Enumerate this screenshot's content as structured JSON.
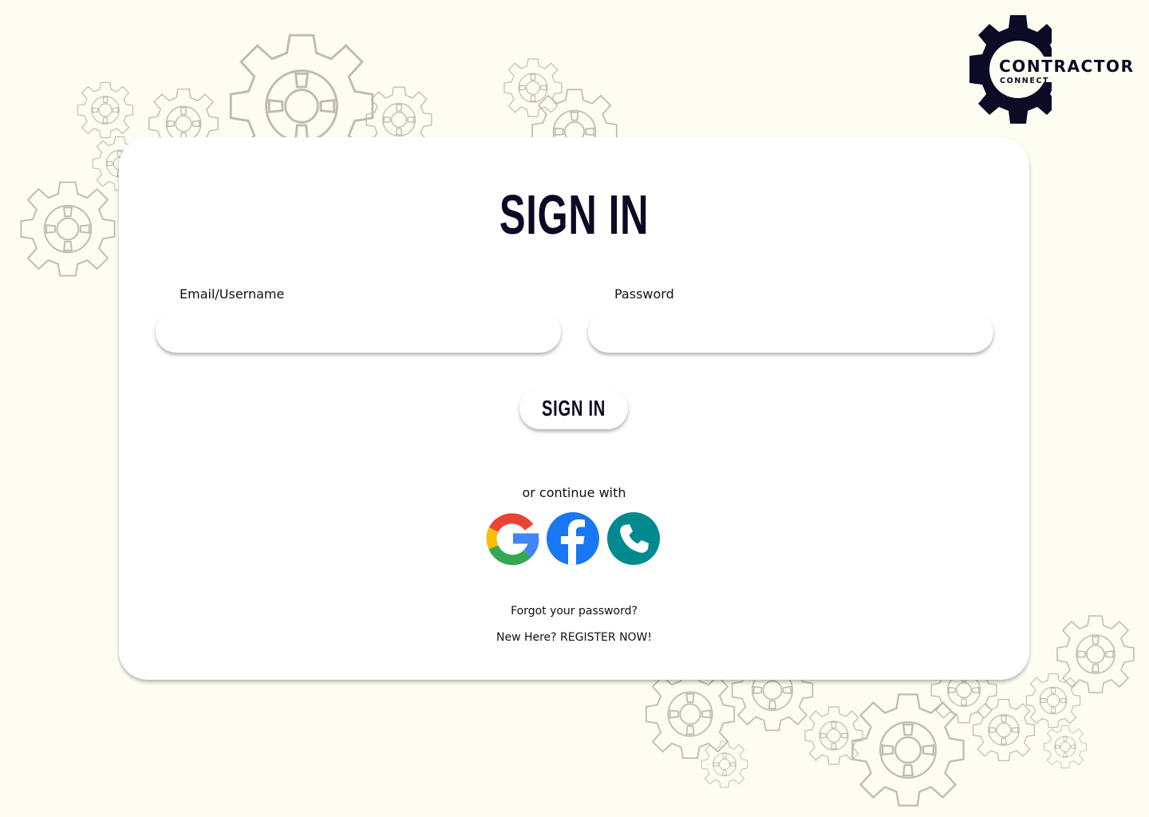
{
  "brand": {
    "name": "CONTRACTOR",
    "tagline": "CONNECT"
  },
  "form": {
    "title": "SIGN IN",
    "email_label": "Email/Username",
    "email_value": "",
    "password_label": "Password",
    "password_value": "",
    "submit_label": "SIGN IN"
  },
  "alt_login": {
    "label": "or continue with",
    "providers": [
      "google-icon",
      "facebook-icon",
      "phone-icon"
    ]
  },
  "links": {
    "forgot": "Forgot your password?",
    "register": "New Here? REGISTER NOW!"
  },
  "colors": {
    "background": "#fdfef1",
    "text_dark": "#0a0a24",
    "facebook": "#1877f2",
    "phone": "#00898f",
    "google_red": "#ea4335",
    "google_yellow": "#fbbc05",
    "google_green": "#34a853",
    "google_blue": "#4285f4"
  }
}
